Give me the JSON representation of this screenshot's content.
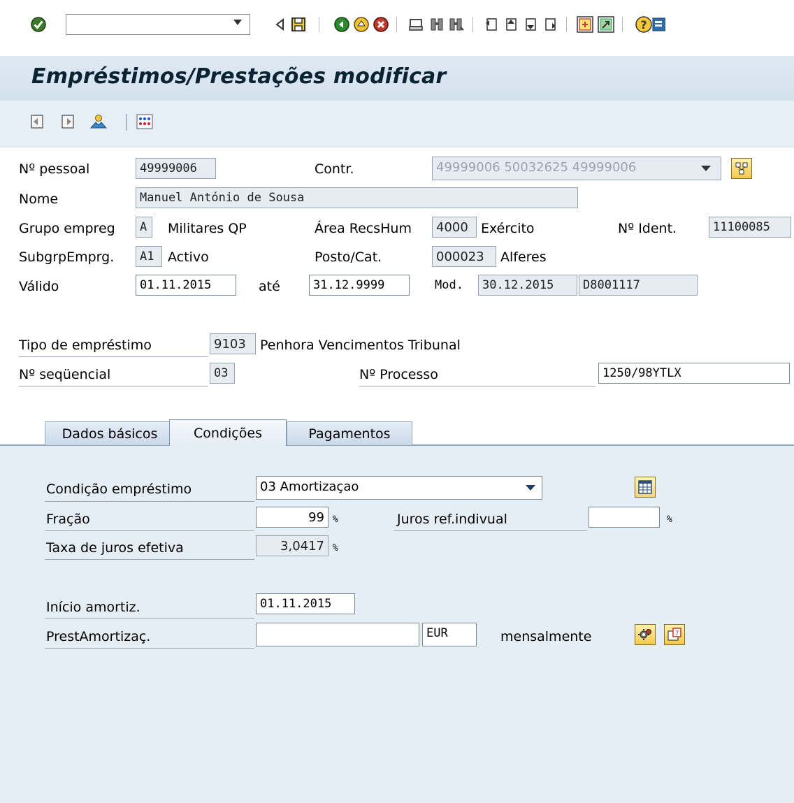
{
  "title": "Empréstimos/Prestações modificar",
  "toolbar": {
    "command_value": "",
    "icons": [
      "enter-icon",
      "back-icon",
      "save-icon",
      "back-green-icon",
      "exit-icon",
      "cancel-icon",
      "print-icon",
      "find-icon",
      "find-next-icon",
      "first-page-icon",
      "previous-page-icon",
      "next-page-icon",
      "last-page-icon",
      "create-session-icon",
      "shortcut-icon",
      "help-icon",
      "customize-layout-icon"
    ]
  },
  "header": {
    "pessoal_label": "Nº pessoal",
    "pessoal_value": "49999006",
    "contr_label": "Contr.",
    "contr_value": "49999006 50032625 49999006",
    "nome_label": "Nome",
    "nome_value": "Manuel António de Sousa",
    "grupo_label": "Grupo empreg",
    "grupo_code": "A",
    "grupo_text": "Militares QP",
    "area_label": "Área RecsHum",
    "area_code": "4000",
    "area_text": "Exército",
    "ident_label": "Nº Ident.",
    "ident_value": "11100085",
    "subgrp_label": "SubgrpEmprg.",
    "subgrp_code": "A1",
    "subgrp_text": "Activo",
    "posto_label": "Posto/Cat.",
    "posto_code": "000023",
    "posto_text": "Alferes",
    "valido_label": "Válido",
    "valido_from": "01.11.2015",
    "ate_label": "até",
    "valido_to": "31.12.9999",
    "mod_label": "Mod.",
    "mod_date": "30.12.2015",
    "mod_user": "D8001117"
  },
  "loan": {
    "tipo_label": "Tipo de empréstimo",
    "tipo_code": "9103",
    "tipo_text": "Penhora Vencimentos Tribunal",
    "seq_label": "Nº seqüencial",
    "seq_value": "03",
    "processo_label": "Nº Processo",
    "processo_value": "1250/98YTLX"
  },
  "tabs": [
    {
      "label": "Dados básicos",
      "active": false
    },
    {
      "label": "Condições",
      "active": true
    },
    {
      "label": "Pagamentos",
      "active": false
    }
  ],
  "conditions": {
    "condicao_label": "Condição empréstimo",
    "condicao_value": "03 Amortizaçao",
    "fracao_label": "Fração",
    "fracao_value": "99",
    "pct_sign": "%",
    "juros_label": "Juros ref.indivual",
    "juros_value": "",
    "taxa_label": "Taxa de juros efetiva",
    "taxa_value": "3,0417",
    "inicio_label": "Início amortiz.",
    "inicio_value": "01.11.2015",
    "prest_label": "PrestAmortizaç.",
    "prest_value": "",
    "currency": "EUR",
    "frequency": "mensalmente"
  }
}
